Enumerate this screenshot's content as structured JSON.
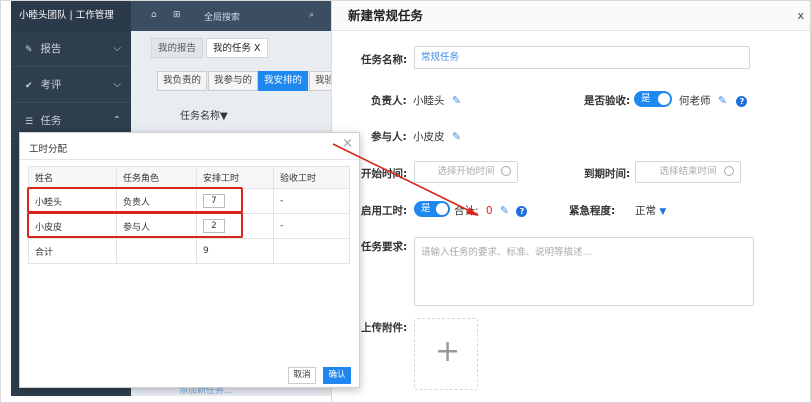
{
  "sidebar": {
    "brand": "小睦头团队 | 工作管理",
    "items": [
      {
        "icon": "edit-icon",
        "label": "报告"
      },
      {
        "icon": "check-icon",
        "label": "考评"
      },
      {
        "icon": "list-icon",
        "label": "任务"
      }
    ]
  },
  "topbar": {
    "search_label": "全局搜索"
  },
  "bg": {
    "tabs": [
      "我的报告",
      "我的任务 X"
    ],
    "subtabs": [
      "我负责的",
      "我参与的",
      "我安排的",
      "我验"
    ],
    "column": "任务名称▼",
    "link": "添加新任务..."
  },
  "panel": {
    "title": "新建常规任务",
    "close": "x",
    "task_name_label": "任务名称:",
    "task_name_value": "常规任务",
    "owner_label": "负责人:",
    "owner_value": "小睦头",
    "accept_label": "是否验收:",
    "accept_toggle": "是",
    "accept_person": "何老师",
    "participant_label": "参与人:",
    "participant_value": "小皮皮",
    "start_label": "开始时间:",
    "start_placeholder": "选择开始时间",
    "due_label": "到期时间:",
    "due_placeholder": "选择结束时间",
    "hours_label": "启用工时:",
    "hours_toggle": "是",
    "hours_total_label": "合计:",
    "hours_total_value": "0",
    "urgency_label": "紧急程度:",
    "urgency_value": "正常",
    "req_label": "任务要求:",
    "req_placeholder": "请输入任务的要求、标准、说明等描述...",
    "attach_label": "上传附件:",
    "upload_plus": "+"
  },
  "modal": {
    "title": "工时分配",
    "close": "×",
    "headers": [
      "姓名",
      "任务角色",
      "安排工时",
      "验收工时"
    ],
    "rows": [
      {
        "name": "小睦头",
        "role": "负责人",
        "hours": "7",
        "accept": "-"
      },
      {
        "name": "小皮皮",
        "role": "参与人",
        "hours": "2",
        "accept": "-"
      }
    ],
    "total_label": "合计",
    "total_value": "9",
    "cancel": "取消",
    "ok": "确认"
  },
  "colors": {
    "accent": "#1e87f0",
    "highlight": "#d9261c",
    "sidebar": "#2e3e4e"
  }
}
